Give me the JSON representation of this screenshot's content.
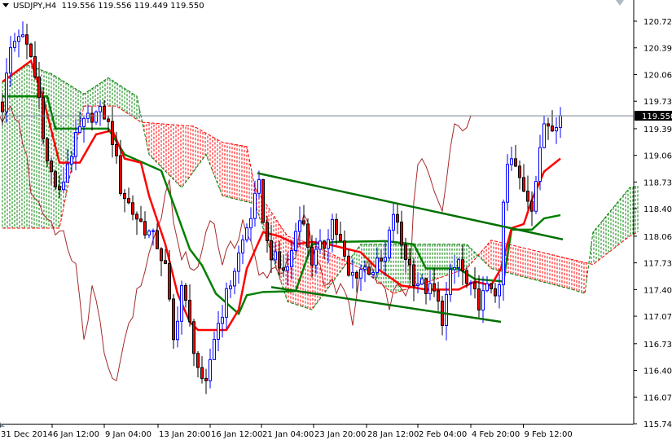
{
  "header": {
    "symbol": "USDJPY,H4",
    "ohlc": "119.556 119.556 119.449 119.550"
  },
  "colors": {
    "bull": "#0000ff",
    "bear_body": "#ff0000",
    "bear_outline": "#000000",
    "tenkan": "#ff0000",
    "kijun": "#008000",
    "chikou": "#a52a2a",
    "cloud_up": "#008000",
    "cloud_down": "#ff0000",
    "trendline": "#007000",
    "price_line": "#708090"
  },
  "chart_data": {
    "type": "candlestick",
    "title": "USDJPY,H4",
    "ylim": [
      115.74,
      120.72
    ],
    "y_ticks": [
      "120.720",
      "120.390",
      "120.060",
      "119.730",
      "119.390",
      "119.060",
      "118.730",
      "118.400",
      "118.060",
      "117.730",
      "117.400",
      "117.070",
      "116.730",
      "116.400",
      "116.070",
      "115.740"
    ],
    "y_tick_values": [
      120.72,
      120.39,
      120.06,
      119.73,
      119.39,
      119.06,
      118.73,
      118.4,
      118.06,
      117.73,
      117.4,
      117.07,
      116.73,
      116.4,
      116.07,
      115.74
    ],
    "x_ticks": [
      "31 Dec 2014",
      "6 Jan 12:00",
      "9 Jan 04:00",
      "13 Jan 20:00",
      "16 Jan 12:00",
      "21 Jan 04:00",
      "23 Jan 20:00",
      "28 Jan 12:00",
      "2 Feb 04:00",
      "4 Feb 20:00",
      "9 Feb 12:00"
    ],
    "x_tick_bars": [
      0,
      25.6,
      51.2,
      77.6,
      103.2,
      128.4,
      154,
      180,
      205.2,
      231.2,
      257
    ],
    "current_price": "119.550",
    "current_price_value": 119.55,
    "close_path": [
      [
        0,
        119.67
      ],
      [
        2,
        120.38
      ],
      [
        4,
        120.58
      ],
      [
        7,
        120.28
      ],
      [
        9,
        119.77
      ],
      [
        11,
        118.97
      ],
      [
        14,
        118.56
      ],
      [
        16,
        118.97
      ],
      [
        19,
        119.37
      ],
      [
        22,
        119.57
      ],
      [
        25,
        119.57
      ],
      [
        27,
        119.27
      ],
      [
        29,
        118.66
      ],
      [
        32,
        118.36
      ],
      [
        35,
        118.16
      ],
      [
        38,
        117.96
      ],
      [
        40,
        117.66
      ],
      [
        42,
        116.75
      ],
      [
        44,
        117.45
      ],
      [
        46,
        116.95
      ],
      [
        48,
        116.45
      ],
      [
        49.6,
        116.04
      ],
      [
        51.6,
        116.75
      ],
      [
        54,
        117.15
      ],
      [
        57,
        117.66
      ],
      [
        60,
        118.16
      ],
      [
        63,
        118.66
      ],
      [
        65,
        117.96
      ],
      [
        68,
        117.66
      ],
      [
        70,
        117.66
      ],
      [
        73,
        118.36
      ],
      [
        76,
        117.76
      ],
      [
        79,
        117.96
      ],
      [
        81,
        118.26
      ],
      [
        83,
        117.96
      ],
      [
        85,
        117.55
      ],
      [
        88,
        117.66
      ],
      [
        91,
        117.66
      ],
      [
        94,
        117.76
      ],
      [
        96,
        118.36
      ],
      [
        98,
        117.96
      ],
      [
        101,
        117.55
      ],
      [
        103,
        117.45
      ],
      [
        106,
        117.35
      ],
      [
        108,
        117.05
      ],
      [
        110,
        117.55
      ],
      [
        112,
        117.76
      ],
      [
        114,
        117.45
      ],
      [
        117,
        117.25
      ],
      [
        120,
        117.45
      ],
      [
        122,
        117.35
      ],
      [
        123,
        118.46
      ],
      [
        124.4,
        119.07
      ],
      [
        126,
        118.87
      ],
      [
        128,
        118.66
      ],
      [
        130,
        118.46
      ],
      [
        132,
        119.07
      ],
      [
        133,
        119.47
      ],
      [
        135,
        119.47
      ],
      [
        137,
        119.55
      ]
    ],
    "tenkan_sen": [
      [
        0,
        119.97
      ],
      [
        7,
        120.23
      ],
      [
        10,
        119.77
      ],
      [
        14,
        118.97
      ],
      [
        19,
        118.97
      ],
      [
        23,
        119.32
      ],
      [
        27,
        119.37
      ],
      [
        30,
        119.02
      ],
      [
        34,
        118.97
      ],
      [
        36,
        118.56
      ],
      [
        40,
        117.96
      ],
      [
        43,
        117.35
      ],
      [
        46,
        117.0
      ],
      [
        48,
        116.9
      ],
      [
        55,
        116.9
      ],
      [
        58,
        117.15
      ],
      [
        60,
        117.66
      ],
      [
        64,
        118.11
      ],
      [
        68,
        118.06
      ],
      [
        72,
        117.96
      ],
      [
        76,
        117.99
      ],
      [
        80,
        117.96
      ],
      [
        84,
        117.91
      ],
      [
        88,
        117.86
      ],
      [
        92,
        117.66
      ],
      [
        98,
        117.45
      ],
      [
        104,
        117.4
      ],
      [
        112,
        117.4
      ],
      [
        116,
        117.5
      ],
      [
        120,
        117.45
      ],
      [
        122.4,
        117.66
      ],
      [
        125,
        118.16
      ],
      [
        128,
        118.21
      ],
      [
        130,
        118.51
      ],
      [
        133,
        118.86
      ],
      [
        137,
        119.02
      ]
    ],
    "kijun_sen": [
      [
        0,
        119.79
      ],
      [
        11,
        119.79
      ],
      [
        13,
        119.39
      ],
      [
        26,
        119.39
      ],
      [
        30,
        119.07
      ],
      [
        39,
        118.87
      ],
      [
        42,
        118.46
      ],
      [
        46,
        117.9
      ],
      [
        49,
        117.7
      ],
      [
        52.4,
        117.35
      ],
      [
        58,
        117.1
      ],
      [
        60,
        117.33
      ],
      [
        64,
        117.37
      ],
      [
        72,
        117.38
      ],
      [
        76,
        117.96
      ],
      [
        82,
        117.99
      ],
      [
        94,
        118.0
      ],
      [
        101,
        117.96
      ],
      [
        104,
        117.66
      ],
      [
        112,
        117.66
      ],
      [
        116,
        117.53
      ],
      [
        123,
        117.5
      ],
      [
        125,
        118.14
      ],
      [
        130,
        118.14
      ],
      [
        133,
        118.28
      ],
      [
        137,
        118.32
      ]
    ],
    "senkou_span_a": [
      [
        0,
        119.97
      ],
      [
        6,
        120.18
      ],
      [
        12,
        120.07
      ],
      [
        20,
        119.82
      ],
      [
        26,
        120.02
      ],
      [
        33,
        119.79
      ],
      [
        36,
        119.07
      ],
      [
        44,
        118.66
      ],
      [
        50,
        119.07
      ],
      [
        54,
        118.56
      ],
      [
        62,
        118.46
      ],
      [
        70,
        117.25
      ],
      [
        76,
        117.15
      ],
      [
        88,
        117.96
      ],
      [
        114,
        117.96
      ],
      [
        120,
        117.66
      ],
      [
        140,
        117.4
      ],
      [
        143,
        117.35
      ],
      [
        145,
        118.11
      ],
      [
        154,
        118.66
      ],
      [
        156,
        118.68
      ]
    ],
    "senkou_span_b": [
      [
        0,
        118.16
      ],
      [
        14,
        118.16
      ],
      [
        20,
        119.67
      ],
      [
        28,
        119.67
      ],
      [
        34,
        119.47
      ],
      [
        47,
        119.42
      ],
      [
        54,
        119.22
      ],
      [
        60,
        119.17
      ],
      [
        62,
        118.66
      ],
      [
        70,
        118.06
      ],
      [
        76,
        117.96
      ],
      [
        88,
        117.66
      ],
      [
        96,
        117.35
      ],
      [
        114,
        117.66
      ],
      [
        120,
        118.01
      ],
      [
        145,
        117.71
      ],
      [
        154,
        118.06
      ],
      [
        156,
        118.11
      ]
    ],
    "chikou_shift_bars": -22,
    "trendlines": [
      {
        "name": "upper",
        "from": [
          62.6,
          118.84
        ],
        "to": [
          137.6,
          118.02
        ]
      },
      {
        "name": "lower",
        "from": [
          66,
          117.43
        ],
        "to": [
          122.4,
          117.0
        ]
      }
    ]
  }
}
